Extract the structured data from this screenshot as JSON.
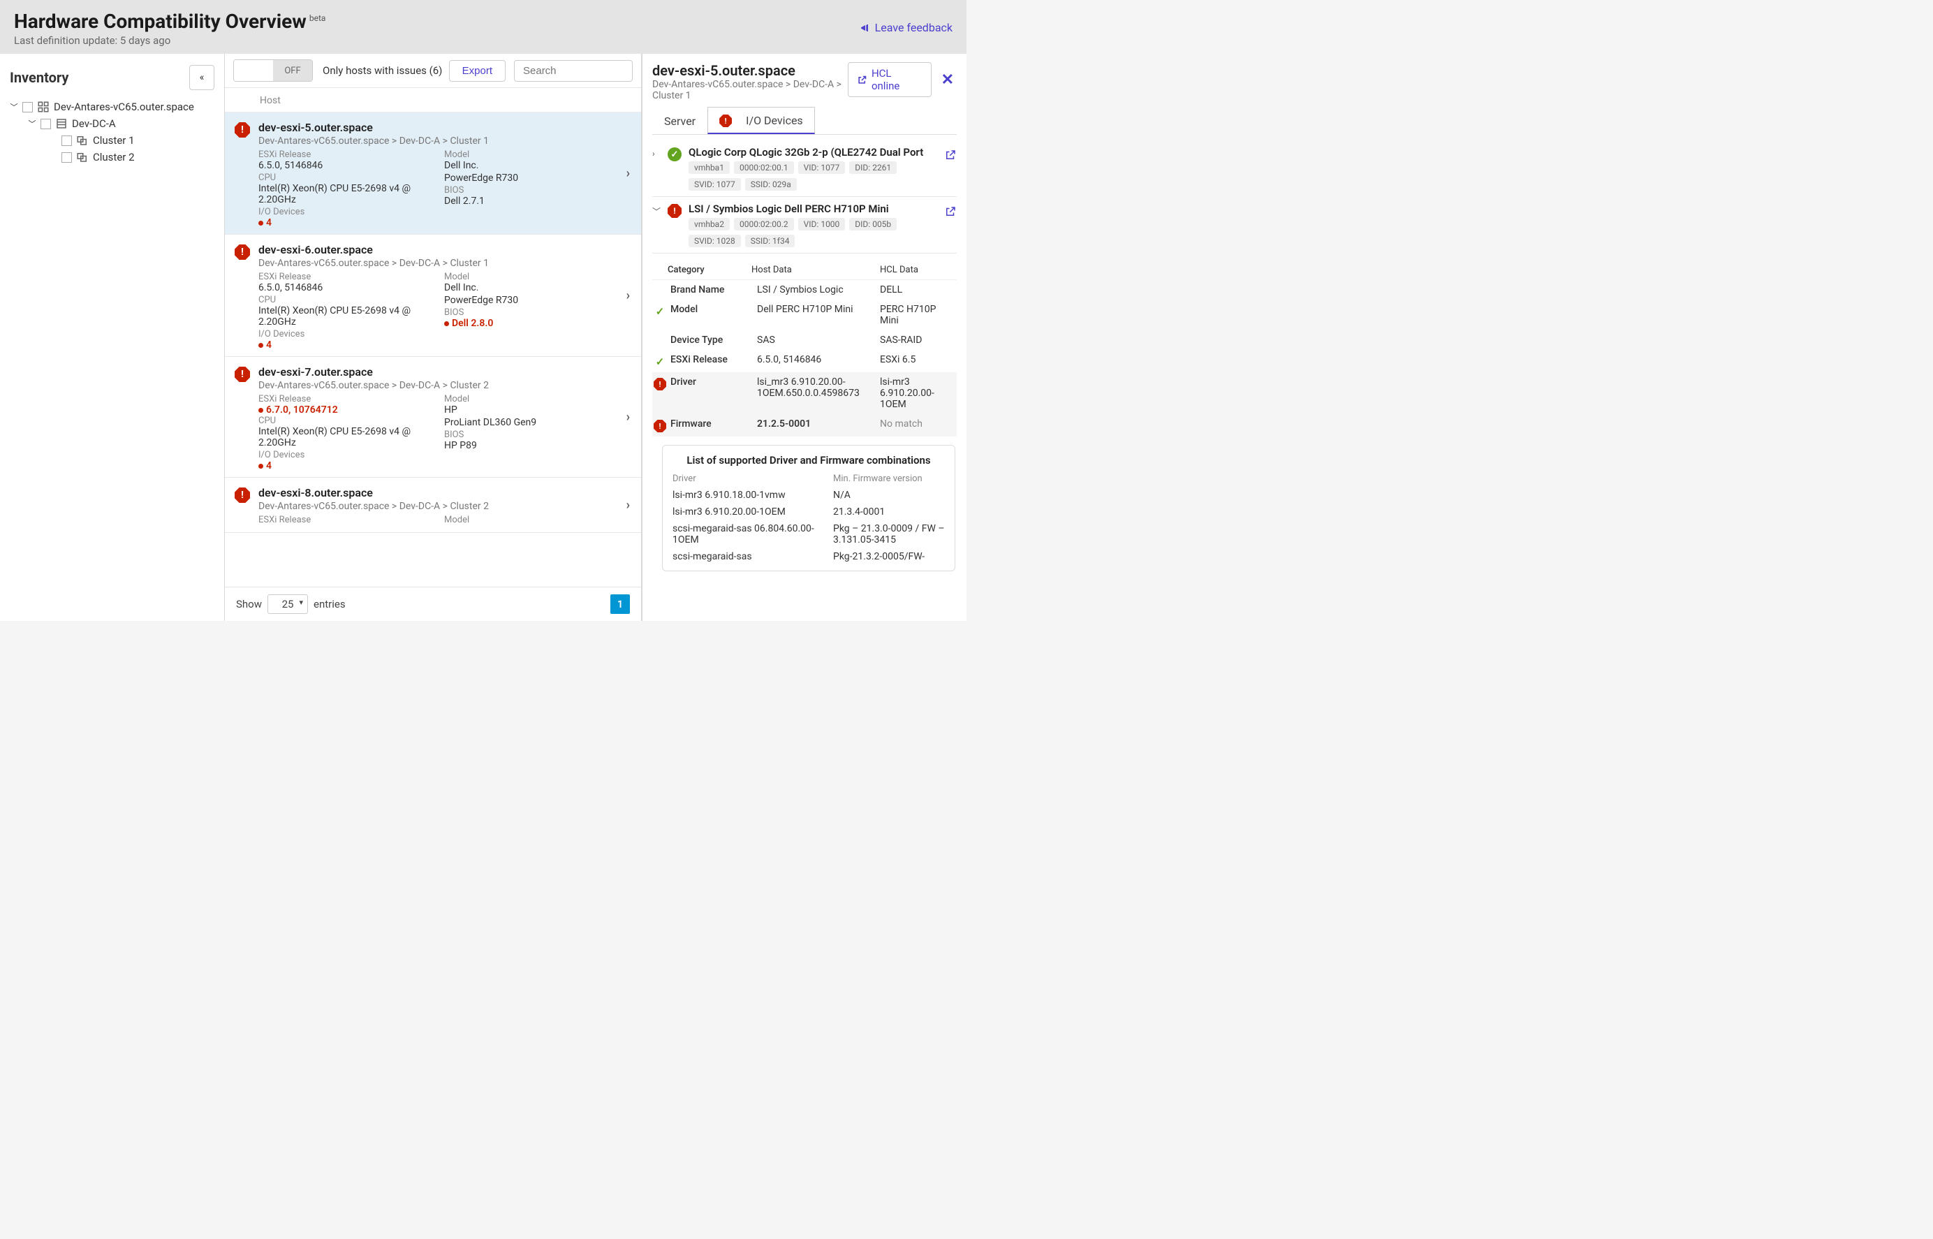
{
  "header": {
    "title": "Hardware Compatibility Overview",
    "beta": "beta",
    "subtitle": "Last definition update: 5 days ago",
    "feedback": "Leave feedback"
  },
  "sidebar": {
    "title": "Inventory",
    "collapse_glyph": "«",
    "root": "Dev-Antares-vC65.outer.space",
    "dc": "Dev-DC-A",
    "cluster1": "Cluster 1",
    "cluster2": "Cluster 2"
  },
  "toolbar": {
    "off": "OFF",
    "filter": "Only hosts with issues (6)",
    "export": "Export",
    "search_ph": "Search"
  },
  "list_header": "Host",
  "hosts": [
    {
      "name": "dev-esxi-5.outer.space",
      "path": "Dev-Antares-vC65.outer.space > Dev-DC-A > Cluster 1",
      "esxi_lbl": "ESXi Release",
      "esxi_val": "6.5.0, 5146846",
      "esxi_err": false,
      "model_lbl": "Model",
      "model_val1": "Dell Inc.",
      "model_val2": "PowerEdge R730",
      "cpu_lbl": "CPU",
      "cpu_val": "Intel(R) Xeon(R) CPU E5-2698 v4 @ 2.20GHz",
      "bios_lbl": "BIOS",
      "bios_val": "Dell 2.7.1",
      "bios_err": false,
      "io_lbl": "I/O Devices",
      "io_val": "4",
      "selected": true
    },
    {
      "name": "dev-esxi-6.outer.space",
      "path": "Dev-Antares-vC65.outer.space > Dev-DC-A > Cluster 1",
      "esxi_lbl": "ESXi Release",
      "esxi_val": "6.5.0, 5146846",
      "esxi_err": false,
      "model_lbl": "Model",
      "model_val1": "Dell Inc.",
      "model_val2": "PowerEdge R730",
      "cpu_lbl": "CPU",
      "cpu_val": "Intel(R) Xeon(R) CPU E5-2698 v4 @ 2.20GHz",
      "bios_lbl": "BIOS",
      "bios_val": "Dell 2.8.0",
      "bios_err": true,
      "io_lbl": "I/O Devices",
      "io_val": "4",
      "selected": false
    },
    {
      "name": "dev-esxi-7.outer.space",
      "path": "Dev-Antares-vC65.outer.space > Dev-DC-A > Cluster 2",
      "esxi_lbl": "ESXi Release",
      "esxi_val": "6.7.0, 10764712",
      "esxi_err": true,
      "model_lbl": "Model",
      "model_val1": "HP",
      "model_val2": "ProLiant DL360 Gen9",
      "cpu_lbl": "CPU",
      "cpu_val": "Intel(R) Xeon(R) CPU E5-2698 v4 @ 2.20GHz",
      "bios_lbl": "BIOS",
      "bios_val": "HP P89",
      "bios_err": false,
      "io_lbl": "I/O Devices",
      "io_val": "4",
      "selected": false
    },
    {
      "name": "dev-esxi-8.outer.space",
      "path": "Dev-Antares-vC65.outer.space > Dev-DC-A > Cluster 2",
      "esxi_lbl": "ESXi Release",
      "esxi_val": "",
      "esxi_err": false,
      "model_lbl": "Model",
      "model_val1": "",
      "model_val2": "",
      "cpu_lbl": "",
      "cpu_val": "",
      "bios_lbl": "",
      "bios_val": "",
      "bios_err": false,
      "io_lbl": "",
      "io_val": "",
      "selected": false
    }
  ],
  "pager": {
    "show": "Show",
    "n": "25",
    "entries": "entries",
    "page": "1"
  },
  "detail": {
    "host": "dev-esxi-5.outer.space",
    "path": "Dev-Antares-vC65.outer.space > Dev-DC-A > Cluster 1",
    "hcl": "HCL online",
    "tab_server": "Server",
    "tab_io": "I/O Devices",
    "devices": [
      {
        "status": "ok",
        "expanded": false,
        "name": "QLogic Corp QLogic 32Gb 2-p (QLE2742 Dual Port",
        "badges": [
          "vmhba1",
          "0000:02:00.1",
          "VID: 1077",
          "DID: 2261",
          "SVID: 1077",
          "SSID: 029a"
        ]
      },
      {
        "status": "err",
        "expanded": true,
        "name": "LSI / Symbios Logic Dell PERC H710P Mini",
        "badges": [
          "vmhba2",
          "0000:02:00.2",
          "VID: 1000",
          "DID: 005b",
          "SVID: 1028",
          "SSID: 1f34"
        ]
      }
    ],
    "cat": {
      "col1": "Category",
      "col2": "Host Data",
      "col3": "HCL Data",
      "rows": [
        {
          "s": "",
          "cat": "Brand Name",
          "host": "LSI / Symbios Logic",
          "hcl": "DELL",
          "hi": false
        },
        {
          "s": "ok",
          "cat": "Model",
          "host": "Dell PERC H710P Mini",
          "hcl": "PERC H710P Mini",
          "hi": false
        },
        {
          "s": "",
          "cat": "Device Type",
          "host": "SAS",
          "hcl": "SAS-RAID",
          "hi": false
        },
        {
          "s": "ok",
          "cat": "ESXi Release",
          "host": "6.5.0, 5146846",
          "hcl": "ESXi 6.5",
          "hi": false
        },
        {
          "s": "err",
          "cat": "Driver",
          "host": "lsi_mr3 6.910.20.00-1OEM.650.0.0.4598673",
          "hcl": "lsi-mr3 6.910.20.00-1OEM",
          "hi": true,
          "hosterr": false
        },
        {
          "s": "err2",
          "cat": "Firmware",
          "host": "21.2.5-0001",
          "hcl": "No match",
          "hi": true,
          "hosterr": true,
          "hclmuted": true
        }
      ]
    },
    "combo": {
      "title": "List of supported Driver and Firmware combinations",
      "h1": "Driver",
      "h2": "Min. Firmware version",
      "rows": [
        {
          "d": "lsi-mr3 6.910.18.00-1vmw",
          "f": "N/A"
        },
        {
          "d": "lsi-mr3 6.910.20.00-1OEM",
          "f": "21.3.4-0001"
        },
        {
          "d": "scsi-megaraid-sas 06.804.60.00-1OEM",
          "f": "Pkg – 21.3.0-0009 / FW – 3.131.05-3415"
        },
        {
          "d": "scsi-megaraid-sas",
          "f": "Pkg-21.3.2-0005/FW-"
        }
      ]
    }
  }
}
